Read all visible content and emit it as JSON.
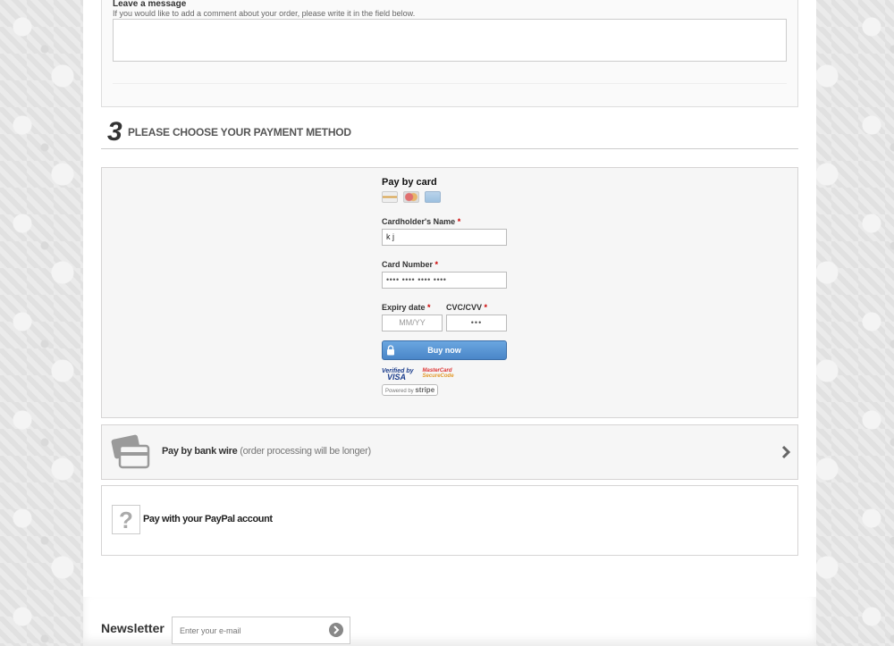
{
  "message": {
    "title": "Leave a message",
    "hint": "If you would like to add a comment about your order, please write it in the field below.",
    "value": ""
  },
  "payment_step": {
    "number": "3",
    "title": "PLEASE CHOOSE YOUR PAYMENT METHOD"
  },
  "card_payment": {
    "title": "Pay by card",
    "card_logos": [
      "visa-card",
      "mastercard-card",
      "amex-card"
    ],
    "cardholder_label": "Cardholder's Name",
    "cardholder_value": "k j",
    "number_label": "Card Number",
    "number_value": "•••• •••• •••• ••••",
    "expiry_label": "Expiry date",
    "expiry_placeholder": "MM/YY",
    "cvc_label": "CVC/CVV",
    "cvc_value": "•••",
    "required_mark": "*",
    "buy_button": "Buy now",
    "verified_visa_line1": "Verified by",
    "verified_visa_line2": "VISA",
    "mastercard_line1": "MasterCard",
    "mastercard_line2": "SecureCode",
    "stripe_powered": "Powered by",
    "stripe_name": "stripe"
  },
  "bank_wire": {
    "label": "Pay by bank wire",
    "note": "(order processing will be longer)"
  },
  "paypal": {
    "label": "Pay with your PayPal account"
  },
  "newsletter": {
    "title": "Newsletter",
    "placeholder": "Enter your e-mail"
  },
  "colors": {
    "accent_button": "#4a86c8",
    "required": "#cc0000"
  }
}
